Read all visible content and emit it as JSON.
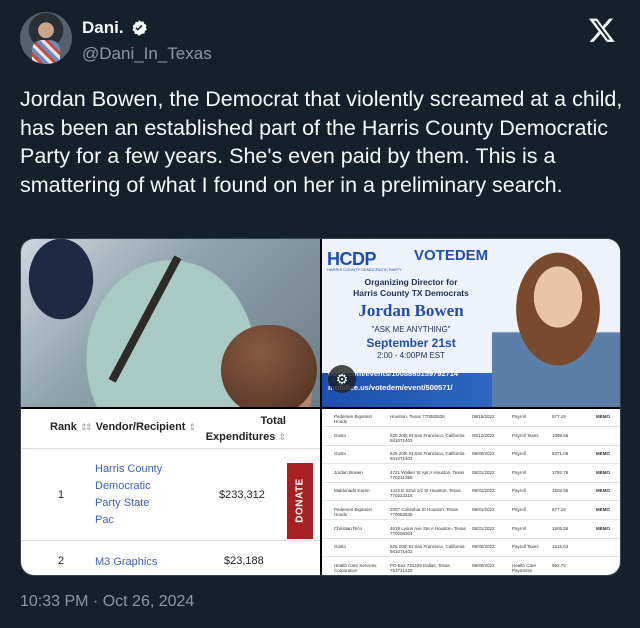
{
  "author": {
    "display_name": "Dani.",
    "handle": "@Dani_In_Texas",
    "verified_icon": "verified-badge-icon"
  },
  "tweet": {
    "text": "Jordan Bowen, the Democrat that violently screamed at a child, has been an established part of the Harris County Democratic Party for a few years. She's even paid by them. This is a smattering of what I found on her in a preliminary search.",
    "timestamp": "10:33 PM · Oct 26, 2024"
  },
  "flyer": {
    "logo": "HCDP",
    "logo_sub": "HARRIS COUNTY DEMOCRATIC PARTY",
    "brand": "VOTEDEM",
    "org_line1": "Organizing Director for",
    "org_line2": "Harris County TX Democrats",
    "name": "Jordan Bowen",
    "tagline": "\"ASK ME ANYTHING\"",
    "date": "September 21st",
    "time": "2:00 - 4:00PM  EST",
    "link1": "book.com/events/1008865159792714",
    "link2": "mobilize.us/votedem/event/500571/"
  },
  "vendor_table": {
    "col_rank": "Rank",
    "col_vendor": "Vendor/Recipient",
    "col_total": "Total Expenditures",
    "rows": [
      {
        "rank": "1",
        "vendor_lines": [
          "Harris County",
          "Democratic",
          "Party State",
          "Pac"
        ],
        "amount": "$233,312"
      },
      {
        "rank": "2",
        "vendor_lines": [
          "M3 Graphics"
        ],
        "amount": "$23,188"
      }
    ],
    "donate_label": "DONATE"
  },
  "ledger": [
    {
      "name": "Pedersen Bigamist Hoods",
      "addr": "Houston, Texas 770082636",
      "date": "08/15/2022",
      "type": "Payroll",
      "amt": "577.19",
      "memo": "MEMO"
    },
    {
      "name": "Gusto",
      "addr": "525 20th St San Francisco, California 941071403",
      "date": "08/12/2022",
      "type": "Payroll Taxes",
      "amt": "1098.56",
      "memo": ""
    },
    {
      "name": "Gusto",
      "addr": "525 20th St San Francisco, California 941071403",
      "date": "08/30/2022",
      "type": "Payroll",
      "amt": "5371.06",
      "memo": "MEMO"
    },
    {
      "name": "Jordan Bowen",
      "addr": "4721 Walker St Apt A Houston, Texas 770231358",
      "date": "08/31/2022",
      "type": "Payroll",
      "amt": "1792.76",
      "memo": "MEMO"
    },
    {
      "name": "Maldonado Karen",
      "addr": "1422 E 32nd 1/2 St Houston, Texas 770223316",
      "date": "08/31/2022",
      "type": "Payroll",
      "amt": "1505.55",
      "memo": "MEMO"
    },
    {
      "name": "Pedersen Bigamist Hoods",
      "addr": "2007 Columbia St Houston, Texas 770082636",
      "date": "08/31/2022",
      "type": "Payroll",
      "amt": "577.19",
      "memo": "MEMO"
    },
    {
      "name": "Christian Rico",
      "addr": "4619 Lyons Ave Ste A Houston, Texas 770206304",
      "date": "08/31/2022",
      "type": "Payroll",
      "amt": "1505.56",
      "memo": "MEMO"
    },
    {
      "name": "Gusto",
      "addr": "525 20th St San Francisco, California 941071403",
      "date": "08/30/2022",
      "type": "Payroll Taxes",
      "amt": "1515.63",
      "memo": ""
    },
    {
      "name": "Health Care Services Corporation",
      "addr": "PO Box 731428 Dallas, Texas 753731428",
      "date": "08/30/2022",
      "type": "Health Care Payments",
      "amt": "962.72",
      "memo": ""
    }
  ]
}
